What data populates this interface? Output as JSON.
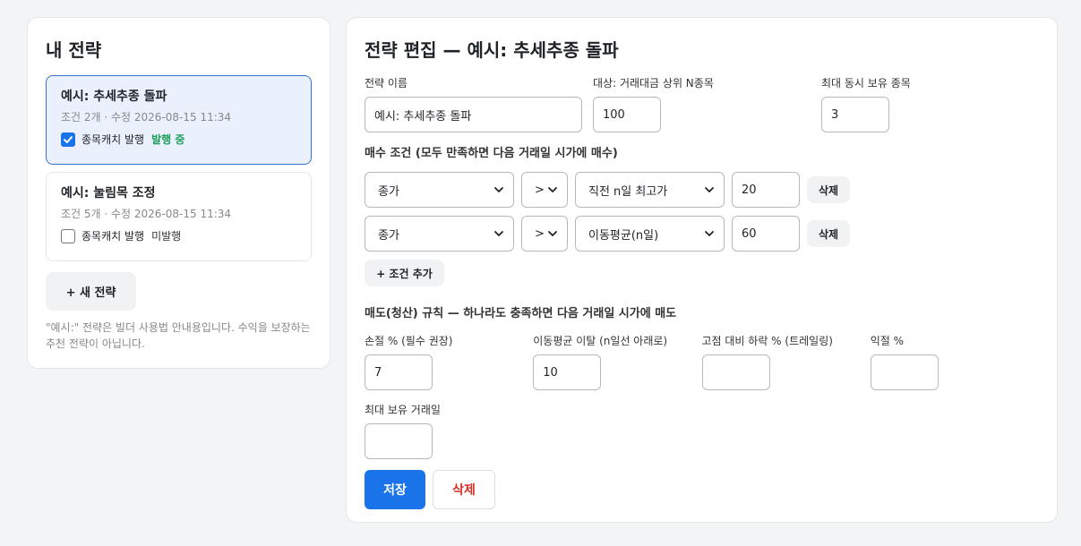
{
  "left": {
    "title": "내 전략",
    "strategies": [
      {
        "name": "예시: 추세추종 돌파",
        "meta": "조건 2개 · 수정 2026-08-15 11:34",
        "catch_label": "종목캐치 발행",
        "status": "발행 중",
        "checked": true
      },
      {
        "name": "예시: 눌림목 조정",
        "meta": "조건 5개 · 수정 2026-08-15 11:34",
        "catch_label": "종목캐치 발행",
        "status": "미발행",
        "checked": false
      }
    ],
    "new_button": "+ 새 전략",
    "note": "\"예시:\" 전략은 빌더 사용법 안내용입니다. 수익을 보장하는 추천 전략이 아닙니다."
  },
  "editor": {
    "title": "전략 편집 — 예시: 추세추종 돌파",
    "name_label": "전략 이름",
    "name_value": "예시: 추세추종 돌파",
    "target_label": "대상: 거래대금 상위 N종목",
    "target_value": "100",
    "max_hold_label": "최대 동시 보유 종목",
    "max_hold_value": "3",
    "buy_title": "매수 조건 (모두 만족하면 다음 거래일 시가에 매수)",
    "conditions": [
      {
        "left": "종가",
        "op": ">",
        "right": "직전 n일 최고가",
        "n": "20",
        "delete": "삭제"
      },
      {
        "left": "종가",
        "op": ">",
        "right": "이동평균(n일)",
        "n": "60",
        "delete": "삭제"
      }
    ],
    "add_condition": "+ 조건 추가",
    "sell_title": "매도(청산) 규칙 — 하나라도 충족하면 다음 거래일 시가에 매도",
    "sell_fields": [
      {
        "label": "손절 % (필수 권장)",
        "value": "7"
      },
      {
        "label": "이동평균 이탈 (n일선 아래로)",
        "value": "10"
      },
      {
        "label": "고점 대비 하락 % (트레일링)",
        "value": ""
      },
      {
        "label": "익절 %",
        "value": ""
      }
    ],
    "max_days_label": "최대 보유 거래일",
    "max_days_value": "",
    "save": "저장",
    "delete": "삭제"
  },
  "colors": {
    "accent": "#1a73e8",
    "published": "#1e9e5b",
    "danger": "#d93025",
    "active_card_bg": "#eaf1fc",
    "active_card_border": "#3572c9"
  },
  "icons": {
    "checkbox": "check-icon",
    "select_arrow": "chevron-down-icon"
  }
}
